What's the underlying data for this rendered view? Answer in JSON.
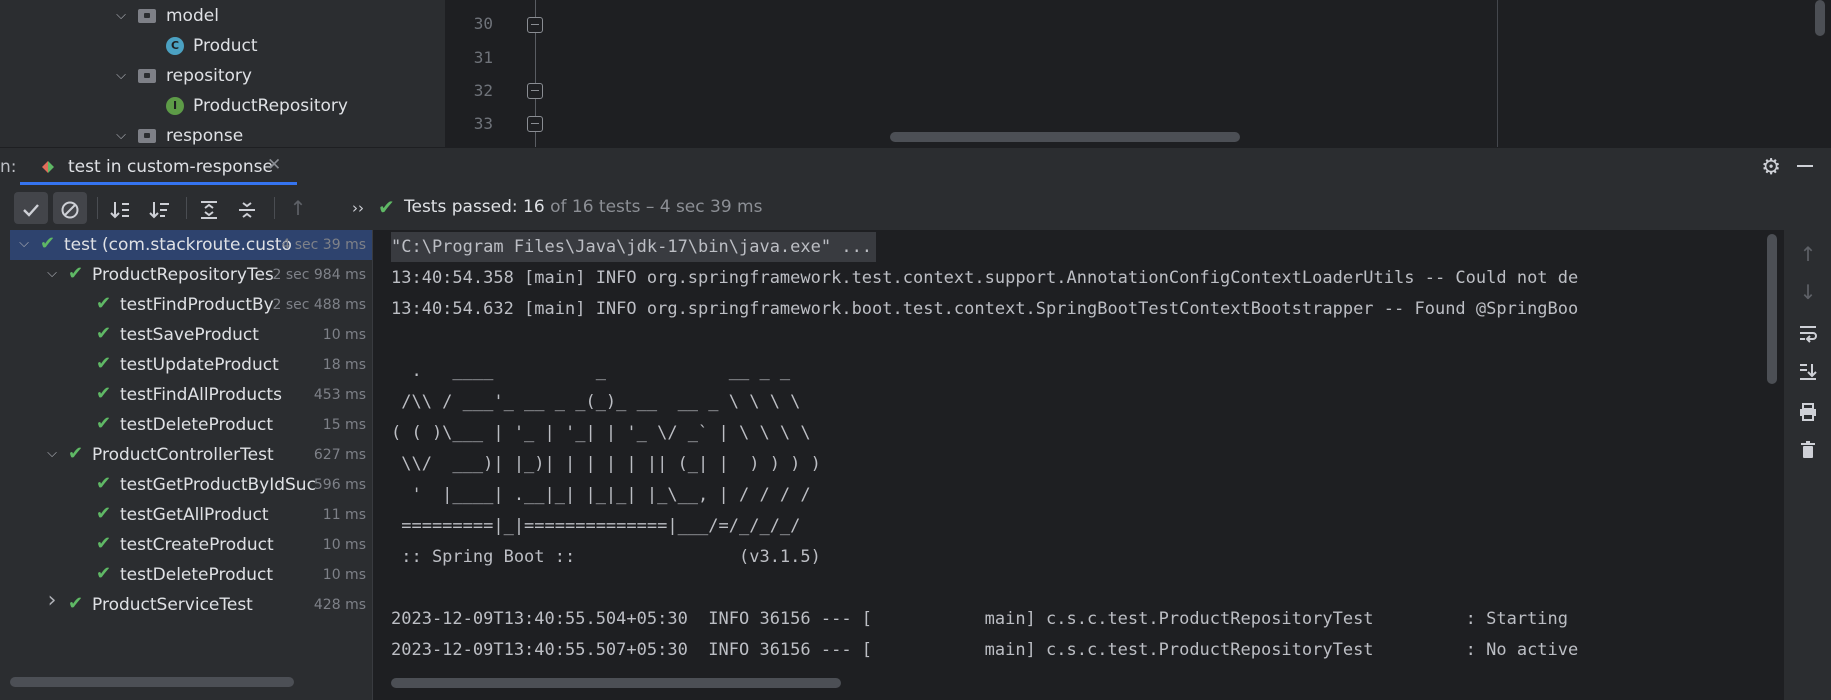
{
  "project_tree": [
    {
      "label": "model",
      "kind": "folder",
      "expanded": true
    },
    {
      "label": "Product",
      "kind": "class",
      "badge": "C"
    },
    {
      "label": "repository",
      "kind": "folder",
      "expanded": true
    },
    {
      "label": "ProductRepository",
      "kind": "interface",
      "badge": "I"
    },
    {
      "label": "response",
      "kind": "folder",
      "expanded": true
    }
  ],
  "editor": {
    "line_numbers": [
      "30",
      "31",
      "32",
      "33"
    ]
  },
  "run_window": {
    "prefix": "n:",
    "tab_label": "test in custom-response",
    "tab_close": "✕"
  },
  "toolbar": {
    "status_label": "Tests passed: 16",
    "status_detail": " of 16 tests – 4 sec 39 ms",
    "more": "››"
  },
  "test_tree": [
    {
      "label": "test (com.stackroute.custo",
      "time": "4 sec 39 ms",
      "level": 0,
      "expanded": true,
      "selected": true
    },
    {
      "label": "ProductRepositoryTes",
      "time": "2 sec 984 ms",
      "level": 1,
      "expanded": true
    },
    {
      "label": "testFindProductBy",
      "time": "2 sec 488 ms",
      "level": 2
    },
    {
      "label": "testSaveProduct",
      "time": "10 ms",
      "level": 2
    },
    {
      "label": "testUpdateProduct",
      "time": "18 ms",
      "level": 2
    },
    {
      "label": "testFindAllProducts",
      "time": "453 ms",
      "level": 2
    },
    {
      "label": "testDeleteProduct",
      "time": "15 ms",
      "level": 2
    },
    {
      "label": "ProductControllerTest",
      "time": "627 ms",
      "level": 1,
      "expanded": true
    },
    {
      "label": "testGetProductByIdSuc",
      "time": "596 ms",
      "level": 2
    },
    {
      "label": "testGetAllProduct",
      "time": "11 ms",
      "level": 2
    },
    {
      "label": "testCreateProduct",
      "time": "10 ms",
      "level": 2
    },
    {
      "label": "testDeleteProduct",
      "time": "10 ms",
      "level": 2
    },
    {
      "label": "ProductServiceTest",
      "time": "428 ms",
      "level": 1,
      "expanded": false
    }
  ],
  "console_lines": [
    "\"C:\\Program Files\\Java\\jdk-17\\bin\\java.exe\" ...",
    "13:40:54.358 [main] INFO org.springframework.test.context.support.AnnotationConfigContextLoaderUtils -- Could not de",
    "13:40:54.632 [main] INFO org.springframework.boot.test.context.SpringBootTestContextBootstrapper -- Found @SpringBoo",
    "",
    "  .   ____          _            __ _ _",
    " /\\\\ / ___'_ __ _ _(_)_ __  __ _ \\ \\ \\ \\",
    "( ( )\\___ | '_ | '_| | '_ \\/ _` | \\ \\ \\ \\",
    " \\\\/  ___)| |_)| | | | | || (_| |  ) ) ) )",
    "  '  |____| .__|_| |_|_| |_\\__, | / / / /",
    " =========|_|==============|___/=/_/_/_/",
    " :: Spring Boot ::                (v3.1.5)",
    "",
    "2023-12-09T13:40:55.504+05:30  INFO 36156 --- [           main] c.s.c.test.ProductRepositoryTest         : Starting",
    "2023-12-09T13:40:55.507+05:30  INFO 36156 --- [           main] c.s.c.test.ProductRepositoryTest         : No active"
  ],
  "colors": {
    "accent": "#3574f0",
    "pass_green": "#5fb865",
    "selection": "#2e436e"
  }
}
